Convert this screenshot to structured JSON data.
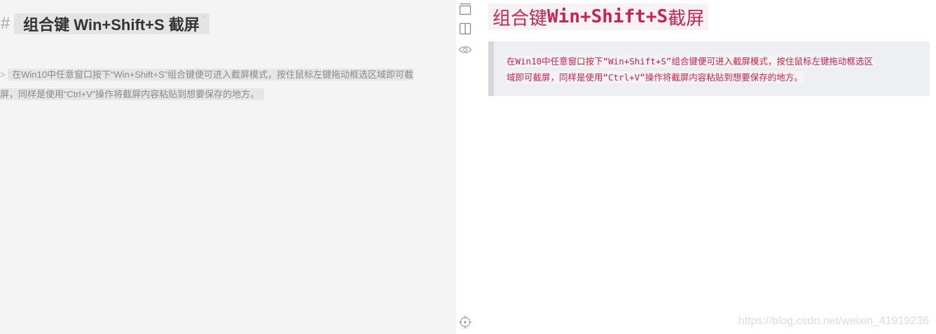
{
  "editor": {
    "heading_marker": "#",
    "heading_text": "组合键 Win+Shift+S 截屏",
    "quote_marker": ">",
    "quote_line1": "在Win10中任意窗口按下“Win+Shift+S”组合键便可进入截屏模式，按住鼠标左键拖动框选区域即可截",
    "quote_line2": "屏，同样是使用“Ctrl+V”操作将截屏内容粘贴到想要保存的地方。",
    "backtick": "`"
  },
  "toolbar": {
    "buttons": [
      {
        "name": "maximize-pane-icon"
      },
      {
        "name": "split-view-icon"
      },
      {
        "name": "preview-eye-icon"
      },
      {
        "name": "sync-scroll-target-icon"
      }
    ]
  },
  "preview": {
    "title_part1": "组合键 ",
    "title_part2": "Win+Shift+S",
    "title_part3": " 截屏",
    "quote_line1": "在Win10中任意窗口按下“Win+Shift+S”组合键便可进入截屏模式，按住鼠标左键拖动框选区",
    "quote_line2": "域即可截屏，同样是使用“Ctrl+V”操作将截屏内容粘贴到想要保存的地方。"
  },
  "watermark": "https://blog.csdn.net/weixin_41919236",
  "colors": {
    "code_red": "#c7254e",
    "code_bg": "#f9f2f4",
    "editor_bg": "#f4f4f4",
    "blockquote_bg": "#eeeff3",
    "blockquote_border": "#d4d7df"
  }
}
